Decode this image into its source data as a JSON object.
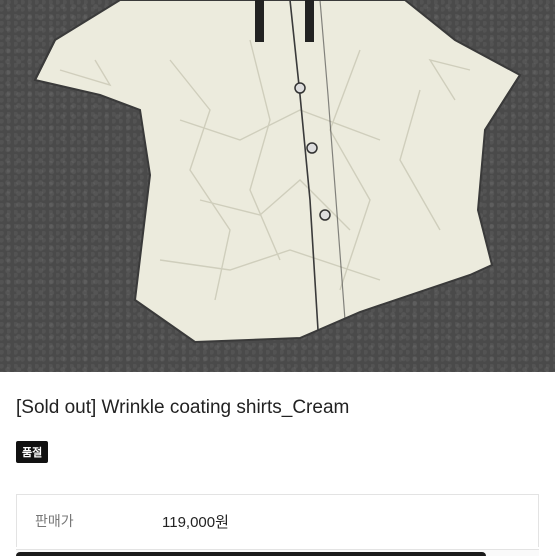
{
  "product": {
    "image_alt": "Cream wrinkle coating short-sleeve shirt on asphalt",
    "title": "[Sold out] Wrinkle coating shirts_Cream",
    "badge": "품절"
  },
  "price_row": {
    "label": "판매가",
    "value": "119,000원"
  }
}
